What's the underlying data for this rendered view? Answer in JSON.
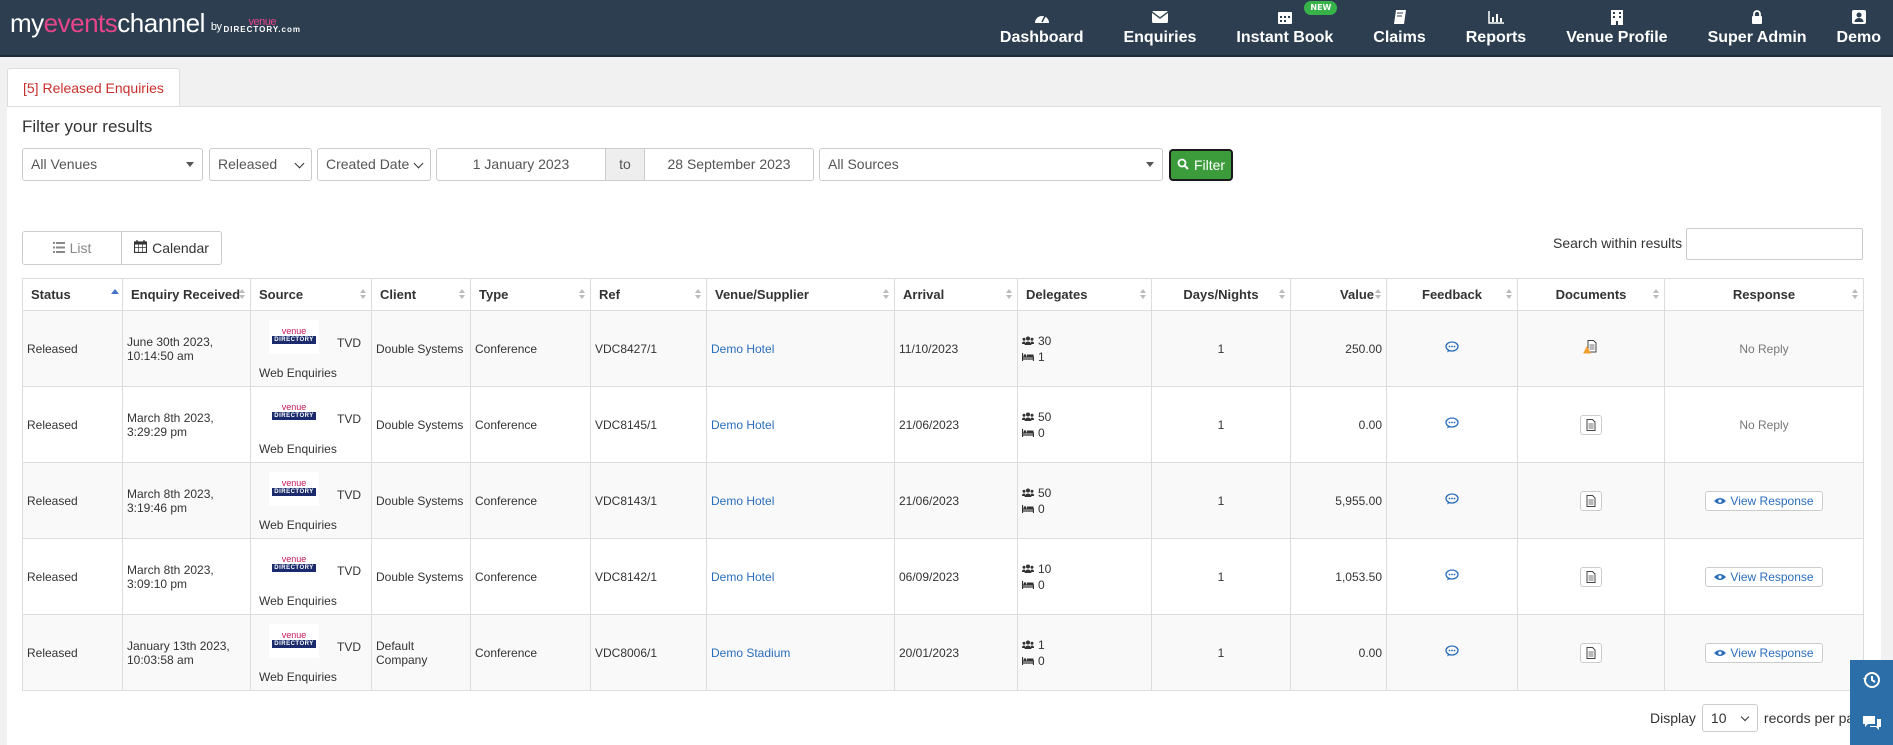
{
  "brand": {
    "my": "my",
    "events": "events",
    "channel": "channel",
    "by": "by",
    "venue": "venue",
    "directory": "DIRECTORY.com"
  },
  "nav": [
    {
      "label": "Dashboard",
      "icon": "dashboard-icon"
    },
    {
      "label": "Enquiries",
      "icon": "envelope-icon"
    },
    {
      "label": "Instant Book",
      "icon": "calendar-icon",
      "badge": "NEW"
    },
    {
      "label": "Claims",
      "icon": "book-icon"
    },
    {
      "label": "Reports",
      "icon": "bar-chart-icon"
    },
    {
      "label": "Venue Profile",
      "icon": "building-icon"
    },
    {
      "label": "Super Admin",
      "icon": "lock-icon"
    },
    {
      "label": "Demo",
      "icon": "user-icon"
    }
  ],
  "tab": {
    "label": "[5] Released Enquiries"
  },
  "filter": {
    "title": "Filter your results",
    "venue": "All Venues",
    "status": "Released",
    "date_type": "Created Date",
    "date_from": "1 January 2023",
    "to": "to",
    "date_to": "28 September 2023",
    "source": "All Sources",
    "button": "Filter"
  },
  "view": {
    "list": "List",
    "calendar": "Calendar"
  },
  "search": {
    "label": "Search within results",
    "value": ""
  },
  "table": {
    "headers": {
      "status": "Status",
      "received": "Enquiry Received",
      "source": "Source",
      "client": "Client",
      "type": "Type",
      "ref": "Ref",
      "venue": "Venue/Supplier",
      "arrival": "Arrival",
      "delegates": "Delegates",
      "days": "Days/Nights",
      "value": "Value",
      "feedback": "Feedback",
      "documents": "Documents",
      "response": "Response"
    },
    "rows": [
      {
        "status": "Released",
        "received_date": "June 30th 2023,",
        "received_time": "10:14:50 am",
        "source_a": "TVD",
        "source_b": "Web Enquiries",
        "client": "Double Systems",
        "type": "Conference",
        "ref": "VDC8427/1",
        "venue": "Demo Hotel",
        "arrival": "11/10/2023",
        "delegates": "30",
        "rooms": "1",
        "days": "1",
        "value": "250.00",
        "response": "No Reply",
        "doc_alert": true
      },
      {
        "status": "Released",
        "received_date": "March 8th 2023,",
        "received_time": "3:29:29 pm",
        "source_a": "TVD",
        "source_b": "Web Enquiries",
        "client": "Double Systems",
        "type": "Conference",
        "ref": "VDC8145/1",
        "venue": "Demo Hotel",
        "arrival": "21/06/2023",
        "delegates": "50",
        "rooms": "0",
        "days": "1",
        "value": "0.00",
        "response": "No Reply",
        "doc_alert": false
      },
      {
        "status": "Released",
        "received_date": "March 8th 2023,",
        "received_time": "3:19:46 pm",
        "source_a": "TVD",
        "source_b": "Web Enquiries",
        "client": "Double Systems",
        "type": "Conference",
        "ref": "VDC8143/1",
        "venue": "Demo Hotel",
        "arrival": "21/06/2023",
        "delegates": "50",
        "rooms": "0",
        "days": "1",
        "value": "5,955.00",
        "response": "View Response",
        "doc_alert": false
      },
      {
        "status": "Released",
        "received_date": "March 8th 2023,",
        "received_time": "3:09:10 pm",
        "source_a": "TVD",
        "source_b": "Web Enquiries",
        "client": "Double Systems",
        "type": "Conference",
        "ref": "VDC8142/1",
        "venue": "Demo Hotel",
        "arrival": "06/09/2023",
        "delegates": "10",
        "rooms": "0",
        "days": "1",
        "value": "1,053.50",
        "response": "View Response",
        "doc_alert": false
      },
      {
        "status": "Released",
        "received_date": "January 13th 2023,",
        "received_time": "10:03:58 am",
        "source_a": "TVD",
        "source_b": "Web Enquiries",
        "client": "Default Company",
        "type": "Conference",
        "ref": "VDC8006/1",
        "venue": "Demo Stadium",
        "arrival": "20/01/2023",
        "delegates": "1",
        "rooms": "0",
        "days": "1",
        "value": "0.00",
        "response": "View Response",
        "doc_alert": false
      }
    ]
  },
  "pagination": {
    "display": "Display",
    "per_page": "10",
    "suffix": "records per pa"
  },
  "colors": {
    "nav_bg": "#2c3e50",
    "accent": "#e8458b",
    "link": "#2a6ebb",
    "filter_btn": "#3c9c3c",
    "tab_text": "#c9302c"
  }
}
